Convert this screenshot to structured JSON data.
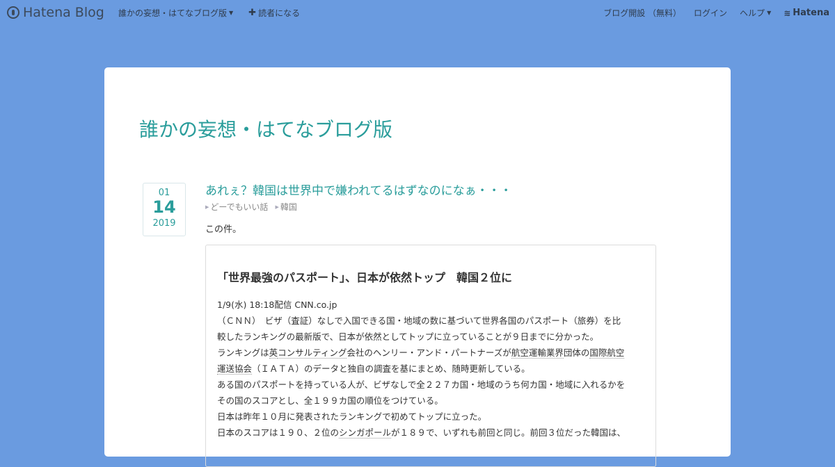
{
  "topbar": {
    "brand": "Hatena Blog",
    "blog_menu": "誰かの妄想・はてなブログ版",
    "subscribe": "読者になる",
    "open_blog": "ブログ開設 （無料）",
    "login": "ログイン",
    "help": "ヘルプ",
    "hatena": "Hatena"
  },
  "blog": {
    "title": "誰かの妄想・はてなブログ版"
  },
  "entry": {
    "date": {
      "month": "01",
      "day": "14",
      "year": "2019"
    },
    "title": "あれぇ？韓国は世界中で嫌われてるはずなのになぁ・・・",
    "categories": [
      "どーでもいい話",
      "韓国"
    ],
    "intro": "この件。",
    "quote": {
      "heading": "「世界最強のパスポート」、日本が依然トップ　韓国２位に",
      "meta": "1/9(水) 18:18配信 CNN.co.jp",
      "lines": {
        "l1": "（ＣＮＮ）　ビザ（査証）なしで入国できる国・地域の数に基づいて世界各国のパスポート（旅券）を比",
        "l2": "較したランキングの最新版で、日本が依然としてトップに立っていることが９日までに分かった。",
        "l3a": "ランキングは",
        "l3k1": "英",
        "l3k2": "コンサルティング",
        "l3b": "会社のヘンリー・アンド・パートナーズが",
        "l3k3": "航空運輸業界",
        "l3c": "団体の",
        "l3k4": "国際航空",
        "l4a": "運送協会",
        "l4b": "（ＩＡＴＡ）のデータと独自の調査を基にまとめ、随時更新している。",
        "l5": "ある国のパスポートを持っている人が、ビザなしで全２２７カ国・地域のうち何カ国・地域に入れるかを",
        "l6": "その国のスコアとし、全１９９カ国の順位をつけている。",
        "l7": "日本は昨年１０月に発表されたランキングで初めてトップに立った。",
        "l8a": "日本のスコアは１９０、２位の",
        "l8k": "シンガポール",
        "l8b": "が１８９で、いずれも前回と同じ。前回３位だった韓国は、"
      }
    }
  }
}
